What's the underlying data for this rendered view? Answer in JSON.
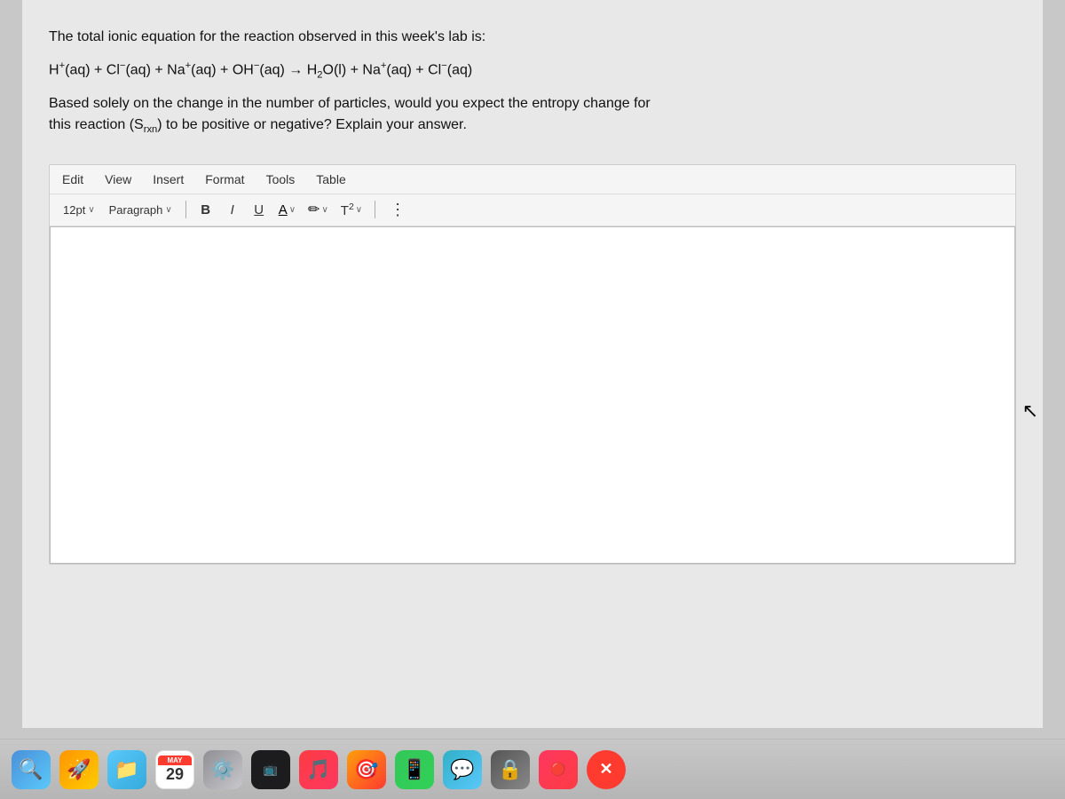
{
  "page": {
    "background_color": "#c8c8c8"
  },
  "content": {
    "question1": "The total ionic equation for the reaction observed in this week's lab is:",
    "equation": "H⁺(aq) + Cl⁻(aq) + Na⁺(aq) + OH⁻(aq) → H₂O(l) + Na⁺(aq) + Cl⁻(aq)",
    "question2_line1": "Based solely on the change in the number of particles, would you expect the entropy change for",
    "question2_line2": "this reaction (S",
    "question2_subscript": "rxn",
    "question2_line3": ") to be positive or negative? Explain your answer."
  },
  "editor": {
    "menu": {
      "edit": "Edit",
      "view": "View",
      "insert": "Insert",
      "format": "Format",
      "tools": "Tools",
      "table": "Table"
    },
    "toolbar": {
      "font_size": "12pt",
      "paragraph": "Paragraph",
      "bold": "B",
      "italic": "I",
      "underline": "U",
      "font_color": "A",
      "highlight": "✏",
      "t_squared": "T²",
      "more": "⋮"
    },
    "text_area_placeholder": ""
  },
  "dock": {
    "items": [
      {
        "id": "finder",
        "icon": "🔍",
        "color": "#4a90d9",
        "label": "Finder"
      },
      {
        "id": "launchpad",
        "icon": "🚀",
        "color": "#ff9500",
        "label": "Launchpad"
      },
      {
        "id": "folder",
        "icon": "📁",
        "color": "#5ac8fa",
        "label": "Folder"
      },
      {
        "id": "calendar",
        "icon": "📅",
        "color": "#ff3b30",
        "label": "Calendar",
        "badge": "MAY\n29"
      },
      {
        "id": "preferences",
        "icon": "⚙️",
        "color": "#8e8e93",
        "label": "System Preferences"
      },
      {
        "id": "tv",
        "icon": "📺",
        "color": "#1c1c1e",
        "label": "TV"
      },
      {
        "id": "music",
        "icon": "🎵",
        "color": "#fc3c44",
        "label": "Music"
      },
      {
        "id": "target",
        "icon": "🎯",
        "color": "#ff9500",
        "label": "App"
      },
      {
        "id": "app1",
        "icon": "📱",
        "color": "#34c759",
        "label": "App"
      },
      {
        "id": "app2",
        "icon": "💬",
        "color": "#30b0c7",
        "label": "Messages"
      },
      {
        "id": "app3",
        "icon": "🔒",
        "color": "#666",
        "label": "App"
      },
      {
        "id": "x-btn",
        "icon": "✕",
        "color": "#ff3b30",
        "label": "Close"
      }
    ]
  }
}
